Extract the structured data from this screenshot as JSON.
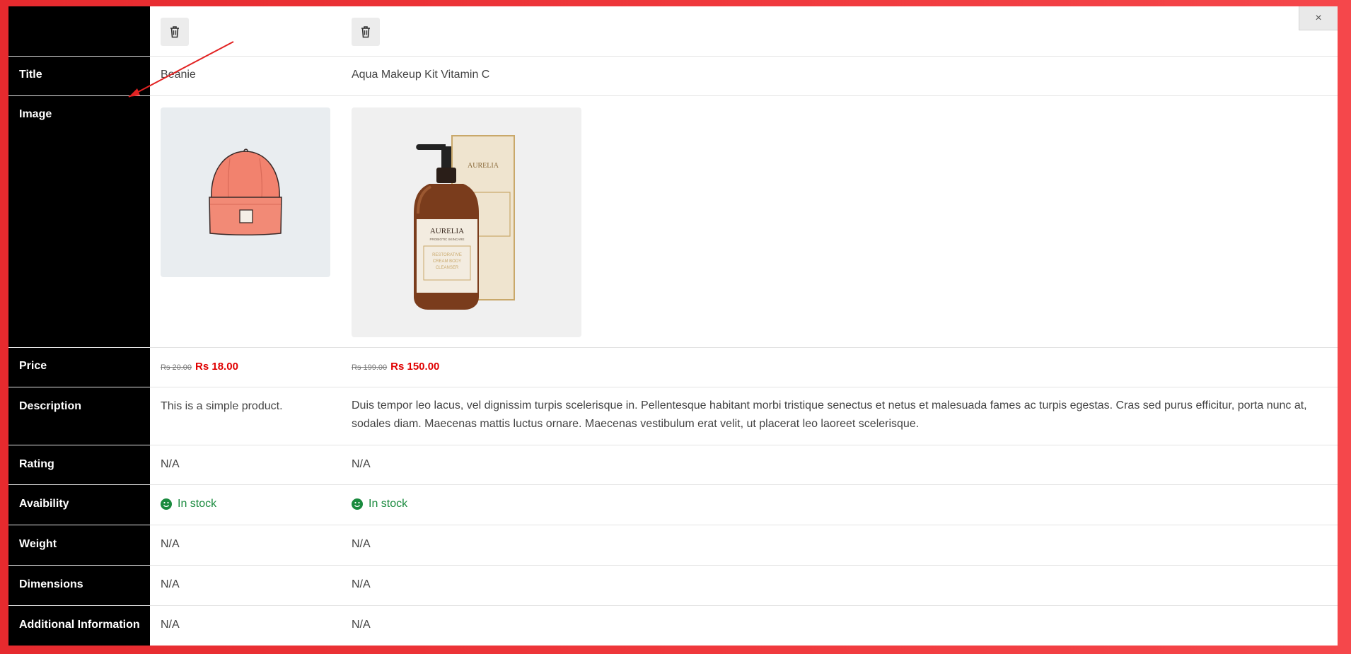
{
  "dialog": {
    "close_label": "×"
  },
  "rows": {
    "title": "Title",
    "image": "Image",
    "price": "Price",
    "description": "Description",
    "rating": "Rating",
    "availability": "Avaibility",
    "weight": "Weight",
    "dimensions": "Dimensions",
    "additional": "Additional Information"
  },
  "products": [
    {
      "title": "Beanie",
      "image_alt": "beanie-image",
      "price_old": "Rs 20.00",
      "price_new": "Rs 18.00",
      "description": "This is a simple product.",
      "rating": "N/A",
      "availability": "In stock",
      "weight": "N/A",
      "dimensions": "N/A",
      "additional": "N/A"
    },
    {
      "title": "Aqua Makeup Kit Vitamin C",
      "image_alt": "aurelia-cleanser-image",
      "price_old": "Rs 199.00",
      "price_new": "Rs 150.00",
      "description": "Duis tempor leo lacus, vel dignissim turpis scelerisque in. Pellentesque habitant morbi tristique senectus et netus et malesuada fames ac turpis egestas. Cras sed purus efficitur, porta nunc at, sodales diam. Maecenas mattis luctus ornare. Maecenas vestibulum erat velit, ut placerat leo laoreet scelerisque.",
      "rating": "N/A",
      "availability": "In stock",
      "weight": "N/A",
      "dimensions": "N/A",
      "additional": "N/A"
    }
  ],
  "image_text": {
    "brand": "AURELIA",
    "subbrand": "PROBIOTIC SKINCARE",
    "product_line1": "RESTORATIVE",
    "product_line2": "CREAM BODY",
    "product_line3": "CLEANSER"
  },
  "colors": {
    "background_red": "#e62a2e",
    "label_column": "#000000",
    "price_accent": "#e00000",
    "stock_green": "#1a8a3e"
  },
  "icons": {
    "remove": "trash-icon",
    "close": "close-icon",
    "stock": "smile-icon"
  }
}
